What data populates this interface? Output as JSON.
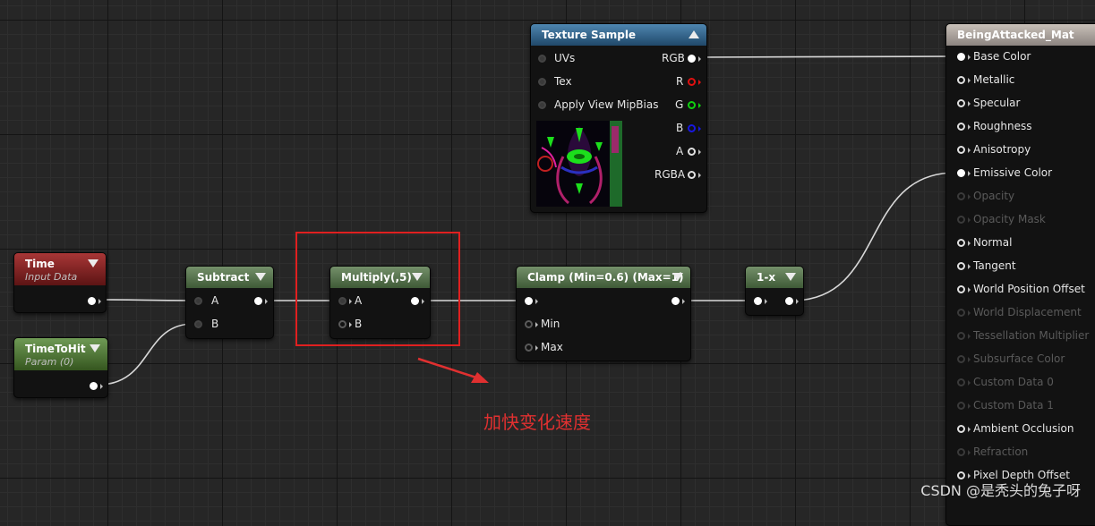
{
  "nodes": {
    "time": {
      "title": "Time",
      "subtitle": "Input Data"
    },
    "timetohit": {
      "title": "TimeToHit",
      "subtitle": "Param (0)"
    },
    "subtract": {
      "title": "Subtract",
      "pins": [
        "A",
        "B"
      ]
    },
    "multiply": {
      "title": "Multiply(,5)",
      "pins": [
        "A",
        "B"
      ]
    },
    "clamp": {
      "title": "Clamp (Min=0.6) (Max=1)",
      "pins": [
        "Min",
        "Max"
      ]
    },
    "oneminus": {
      "title": "1-x"
    },
    "texture": {
      "title": "Texture Sample",
      "inputs": [
        "UVs",
        "Tex",
        "Apply View MipBias"
      ],
      "outputs": [
        "RGB",
        "R",
        "G",
        "B",
        "A",
        "RGBA"
      ]
    },
    "material": {
      "title": "BeingAttacked_Mat",
      "pins": [
        {
          "label": "Base Color",
          "enabled": true
        },
        {
          "label": "Metallic",
          "enabled": true
        },
        {
          "label": "Specular",
          "enabled": true
        },
        {
          "label": "Roughness",
          "enabled": true
        },
        {
          "label": "Anisotropy",
          "enabled": true
        },
        {
          "label": "Emissive Color",
          "enabled": true
        },
        {
          "label": "Opacity",
          "enabled": false
        },
        {
          "label": "Opacity Mask",
          "enabled": false
        },
        {
          "label": "Normal",
          "enabled": true
        },
        {
          "label": "Tangent",
          "enabled": true
        },
        {
          "label": "World Position Offset",
          "enabled": true
        },
        {
          "label": "World Displacement",
          "enabled": false
        },
        {
          "label": "Tessellation Multiplier",
          "enabled": false
        },
        {
          "label": "Subsurface Color",
          "enabled": false
        },
        {
          "label": "Custom Data 0",
          "enabled": false
        },
        {
          "label": "Custom Data 1",
          "enabled": false
        },
        {
          "label": "Ambient Occlusion",
          "enabled": true
        },
        {
          "label": "Refraction",
          "enabled": false
        },
        {
          "label": "Pixel Depth Offset",
          "enabled": true
        }
      ]
    }
  },
  "annotation": {
    "text": "加快变化速度",
    "color": "#e03030"
  },
  "watermark": "CSDN @是秃头的兔子呀",
  "colors": {
    "grid_bg": "#262626",
    "wire": "#d8d8d8",
    "highlight": "#e02020",
    "header_green": "#5a7a4e",
    "header_blue": "#2e6690",
    "header_red": "#8a2222",
    "header_material": "#a8a09a"
  }
}
